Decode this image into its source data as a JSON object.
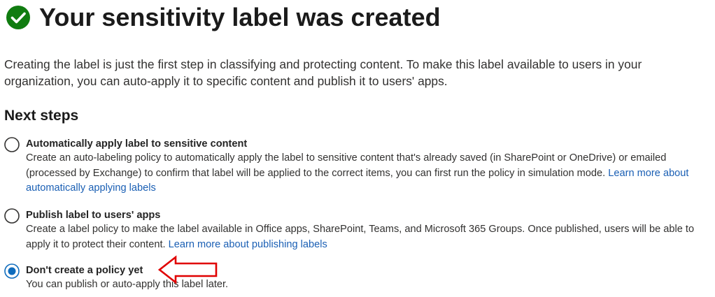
{
  "header": {
    "icon": "check-circle-icon",
    "title": "Your sensitivity label was created"
  },
  "intro": "Creating the label is just the first step in classifying and protecting content. To make this label available to users in your organization, you can auto-apply it to specific content and publish it to users' apps.",
  "next_steps": {
    "heading": "Next steps",
    "options": [
      {
        "title": "Automatically apply label to sensitive content",
        "description": "Create an auto-labeling policy to automatically apply the label to sensitive content that's already saved (in SharePoint or OneDrive) or emailed (processed by Exchange) to confirm that label will be applied to the correct items, you can first run the policy in simulation mode.",
        "link": "Learn more about automatically applying labels",
        "selected": false
      },
      {
        "title": "Publish label to users' apps",
        "description": "Create a label policy to make the label available in Office apps, SharePoint, Teams, and Microsoft 365 Groups. Once published, users will be able to apply it to protect their content.",
        "link": "Learn more about publishing labels",
        "selected": false
      },
      {
        "title": "Don't create a policy yet",
        "description": "You can publish or auto-apply this label later.",
        "link": "",
        "selected": true
      }
    ]
  },
  "colors": {
    "success": "#107c10",
    "accent": "#0f6cbd",
    "link": "#1a5fb4",
    "annotation": "#e00000"
  }
}
